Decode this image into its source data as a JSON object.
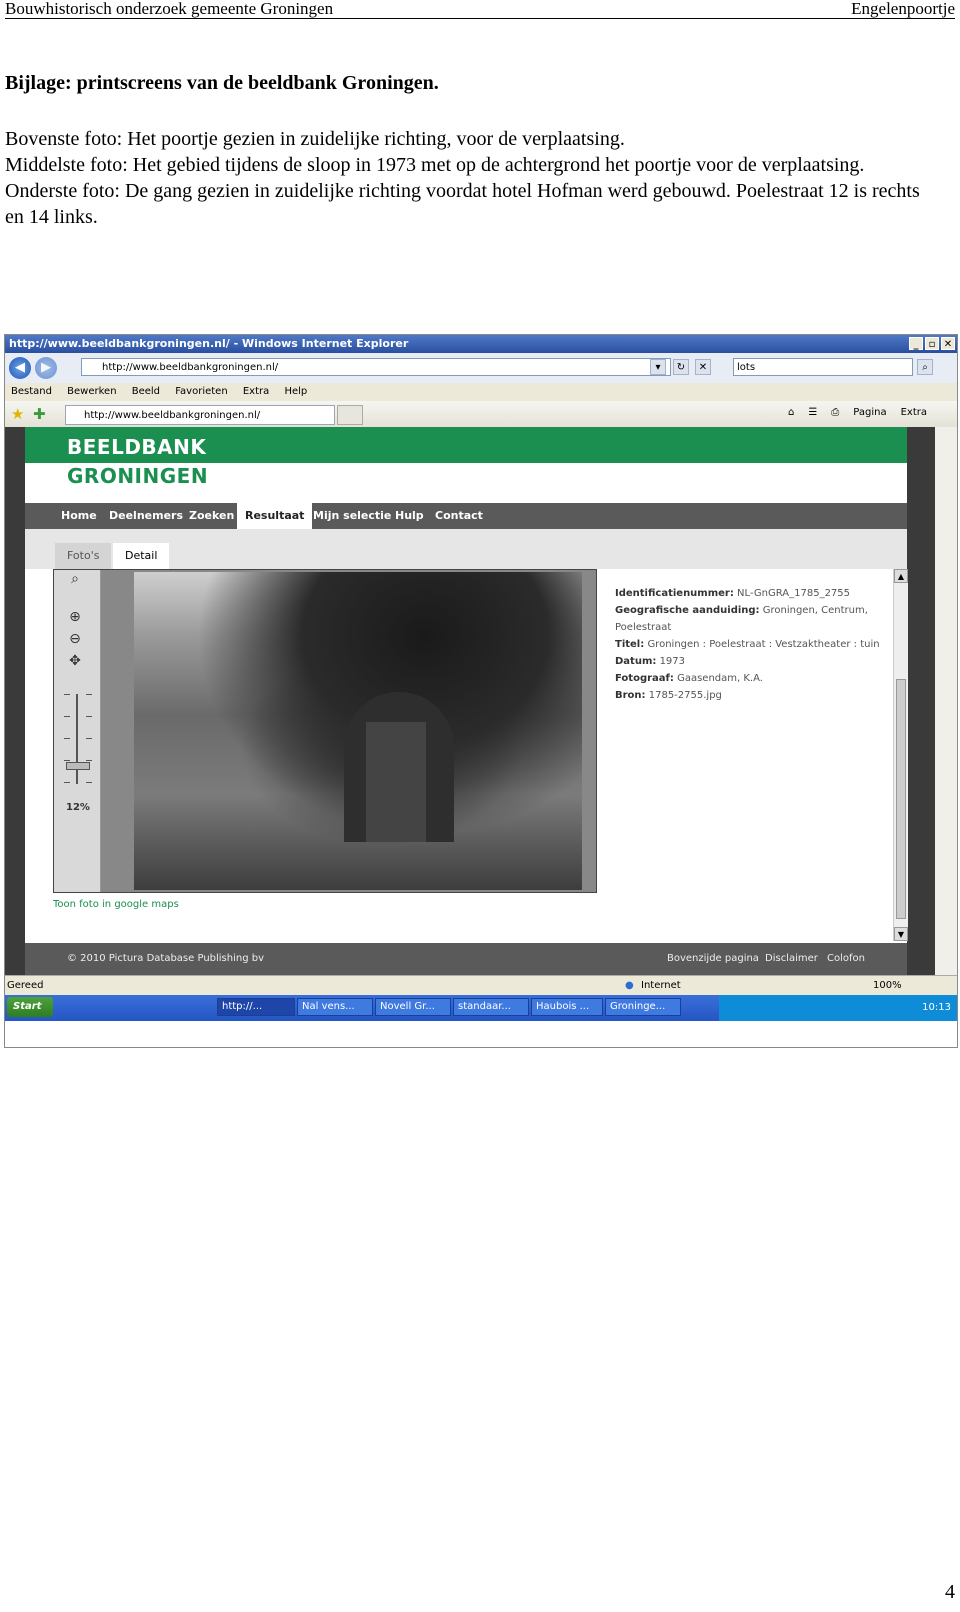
{
  "doc_header": {
    "left": "Bouwhistorisch onderzoek gemeente Groningen",
    "right": "Engelenpoortje"
  },
  "title": "Bijlage: printscreens van de beeldbank Groningen.",
  "paragraphs": [
    "Bovenste foto: Het poortje gezien in zuidelijke richting, voor de verplaatsing.",
    "Middelste foto: Het gebied tijdens de sloop in 1973 met op de achtergrond het poortje voor de verplaatsing.",
    "Onderste foto: De gang gezien in zuidelijke richting voordat hotel Hofman werd gebouwd. Poelestraat 12 is rechts en 14 links."
  ],
  "page_number": "4",
  "browser": {
    "window_title": "http://www.beeldbankgroningen.nl/ - Windows Internet Explorer",
    "address": "http://www.beeldbankgroningen.nl/",
    "search_value": "lots",
    "menu": [
      "Bestand",
      "Bewerken",
      "Beeld",
      "Favorieten",
      "Extra",
      "Help"
    ],
    "fav_tab": "http://www.beeldbankgroningen.nl/",
    "tools": {
      "page": "Pagina",
      "extra": "Extra"
    },
    "status_left": "Gereed",
    "status_zone": "Internet",
    "zoom": "100%"
  },
  "site": {
    "logo_line1": "BEELDBANK",
    "logo_line2": "GRONINGEN",
    "nav": [
      "Home",
      "Deelnemers",
      "Zoeken",
      "Resultaat",
      "Mijn selectie",
      "Hulp",
      "Contact"
    ],
    "subtabs": [
      "Foto's",
      "Detail"
    ],
    "zoom_level": "12%",
    "maps_link": "Toon foto in google maps",
    "meta": [
      {
        "label": "Identificatienummer:",
        "value": "NL-GnGRA_1785_2755"
      },
      {
        "label": "Geografische aanduiding:",
        "value": "Groningen, Centrum, Poelestraat"
      },
      {
        "label": "Titel:",
        "value": "Groningen : Poelestraat : Vestzaktheater : tuin"
      },
      {
        "label": "Datum:",
        "value": "1973"
      },
      {
        "label": "Fotograaf:",
        "value": "Gaasendam, K.A."
      },
      {
        "label": "Bron:",
        "value": "1785-2755.jpg"
      }
    ],
    "copyright": "© 2010 Pictura Database Publishing bv",
    "footer_links": [
      "Bovenzijde pagina",
      "Disclaimer",
      "Colofon"
    ]
  },
  "taskbar": {
    "start": "Start",
    "tasks": [
      "http://...",
      "Nal vens...",
      "Novell Gr...",
      "standaar...",
      "Haubois ...",
      "Groninge..."
    ],
    "clock": "10:13"
  }
}
